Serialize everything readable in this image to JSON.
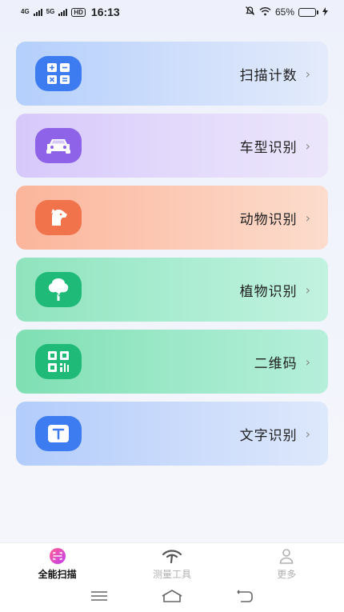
{
  "status_bar": {
    "network_1": "4G",
    "network_2": "5G",
    "hd_badge": "HD",
    "time": "16:13",
    "battery_percent": "65%",
    "battery_level": 0.65
  },
  "cards": [
    {
      "label": "扫描计数",
      "icon": "calculator-icon",
      "color": "#3d7cf0"
    },
    {
      "label": "车型识别",
      "icon": "car-icon",
      "color": "#8e63e8"
    },
    {
      "label": "动物识别",
      "icon": "dog-icon",
      "color": "#f0734c"
    },
    {
      "label": "植物识别",
      "icon": "tree-icon",
      "color": "#1fba78"
    },
    {
      "label": "二维码",
      "icon": "qr-code-icon",
      "color": "#1fba78"
    },
    {
      "label": "文字识别",
      "icon": "text-t-icon",
      "color": "#3d7cf0"
    }
  ],
  "bottom_nav": [
    {
      "label": "全能扫描",
      "icon": "scan-icon",
      "active": true
    },
    {
      "label": "测量工具",
      "icon": "measure-icon",
      "active": false
    },
    {
      "label": "更多",
      "icon": "person-icon",
      "active": false
    }
  ]
}
